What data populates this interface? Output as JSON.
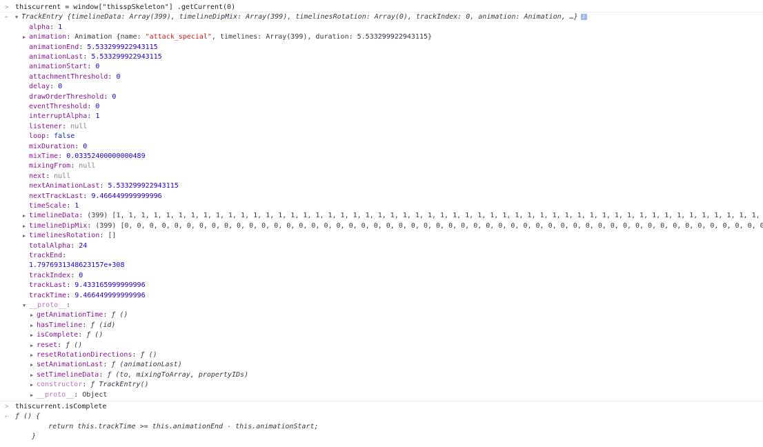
{
  "console": {
    "cmd1": "thiscurrent = window[\"thisspSkeleton\"] .getCurrent(0)",
    "entry": {
      "type": "TrackEntry",
      "summary": "{timelineData: Array(399), timelineDipMix: Array(399), timelinesRotation: Array(0), trackIndex: 0, animation: Animation, …}",
      "info": "i",
      "props": [
        {
          "k": "alpha",
          "v": "1",
          "t": "num"
        },
        {
          "k": "animation",
          "v": "Animation {name: \"attack_special\", timelines: Array(399), duration: 5.533299922943115}",
          "t": "obj",
          "expand": true
        },
        {
          "k": "animationEnd",
          "v": "5.533299922943115",
          "t": "num"
        },
        {
          "k": "animationLast",
          "v": "5.533299922943115",
          "t": "num"
        },
        {
          "k": "animationStart",
          "v": "0",
          "t": "num"
        },
        {
          "k": "attachmentThreshold",
          "v": "0",
          "t": "num"
        },
        {
          "k": "delay",
          "v": "0",
          "t": "num"
        },
        {
          "k": "drawOrderThreshold",
          "v": "0",
          "t": "num"
        },
        {
          "k": "eventThreshold",
          "v": "0",
          "t": "num"
        },
        {
          "k": "interruptAlpha",
          "v": "1",
          "t": "num"
        },
        {
          "k": "listener",
          "v": "null",
          "t": "nul"
        },
        {
          "k": "loop",
          "v": "false",
          "t": "kw"
        },
        {
          "k": "mixDuration",
          "v": "0",
          "t": "num"
        },
        {
          "k": "mixTime",
          "v": "0.03352400000000489",
          "t": "num"
        },
        {
          "k": "mixingFrom",
          "v": "null",
          "t": "nul"
        },
        {
          "k": "next",
          "v": "null",
          "t": "nul"
        },
        {
          "k": "nextAnimationLast",
          "v": "5.533299922943115",
          "t": "num"
        },
        {
          "k": "nextTrackLast",
          "v": "9.466449999999996",
          "t": "num"
        },
        {
          "k": "timeScale",
          "v": "1",
          "t": "num"
        },
        {
          "k": "timelineData",
          "v": "(399) [1, 1, 1, 1, 1, 1, 1, 1, 1, 1, 1, 1, 1, 1, 1, 1, 1, 1, 1, 1, 1, 1, 1, 1, 1, 1, 1, 1, 1, 1, 1, 1, 1, 1, 1, 1, 1, 1, 1, 1, 1, 1, 1, 1, 1, 1, 1, 1, 1, 1, 1, 1, 1, 1, 1, 1, 1, …",
          "t": "obj",
          "expand": true
        },
        {
          "k": "timelineDipMix",
          "v": "(399) [0, 0, 0, 0, 0, 0, 0, 0, 0, 0, 0, 0, 0, 0, 0, 0, 0, 0, 0, 0, 0, 0, 0, 0, 0, 0, 0, 0, 0, 0, 0, 0, 0, 0, 0, 0, 0, 0, 0, 0, 0, 0, 0, 0, 0, 0, 0, 0, 0, 0, 0, 0, 0, 0, 0, 0, 0…",
          "t": "obj",
          "expand": true
        },
        {
          "k": "timelinesRotation",
          "v": "[]",
          "t": "obj",
          "expand": true
        },
        {
          "k": "totalAlpha",
          "v": "24",
          "t": "num"
        },
        {
          "k": "trackEnd",
          "v": "",
          "t": "num"
        },
        {
          "k": "",
          "v": "1.7976931348623157e+308",
          "t": "num"
        },
        {
          "k": "trackIndex",
          "v": "0",
          "t": "num"
        },
        {
          "k": "trackLast",
          "v": "9.433165999999996",
          "t": "num"
        },
        {
          "k": "trackTime",
          "v": "9.466449999999996",
          "t": "num"
        }
      ],
      "proto_label": "__proto__",
      "proto": [
        {
          "k": "getAnimationTime",
          "v": "ƒ ()"
        },
        {
          "k": "hasTimeline",
          "v": "ƒ (id)"
        },
        {
          "k": "isComplete",
          "v": "ƒ ()"
        },
        {
          "k": "reset",
          "v": "ƒ ()"
        },
        {
          "k": "resetRotationDirections",
          "v": "ƒ ()"
        },
        {
          "k": "setAnimationLast",
          "v": "ƒ (animationLast)"
        },
        {
          "k": "setTimelineData",
          "v": "ƒ (to, mixingToArray, propertyIDs)"
        },
        {
          "k": "constructor",
          "v": "ƒ TrackEntry()"
        },
        {
          "k": "__proto__",
          "v": "Object"
        }
      ]
    },
    "cmd2": "thiscurrent.isComplete",
    "result_lines": [
      "ƒ () {",
      "        return this.trackTime >= this.animationEnd - this.animationStart;",
      "    }"
    ]
  }
}
